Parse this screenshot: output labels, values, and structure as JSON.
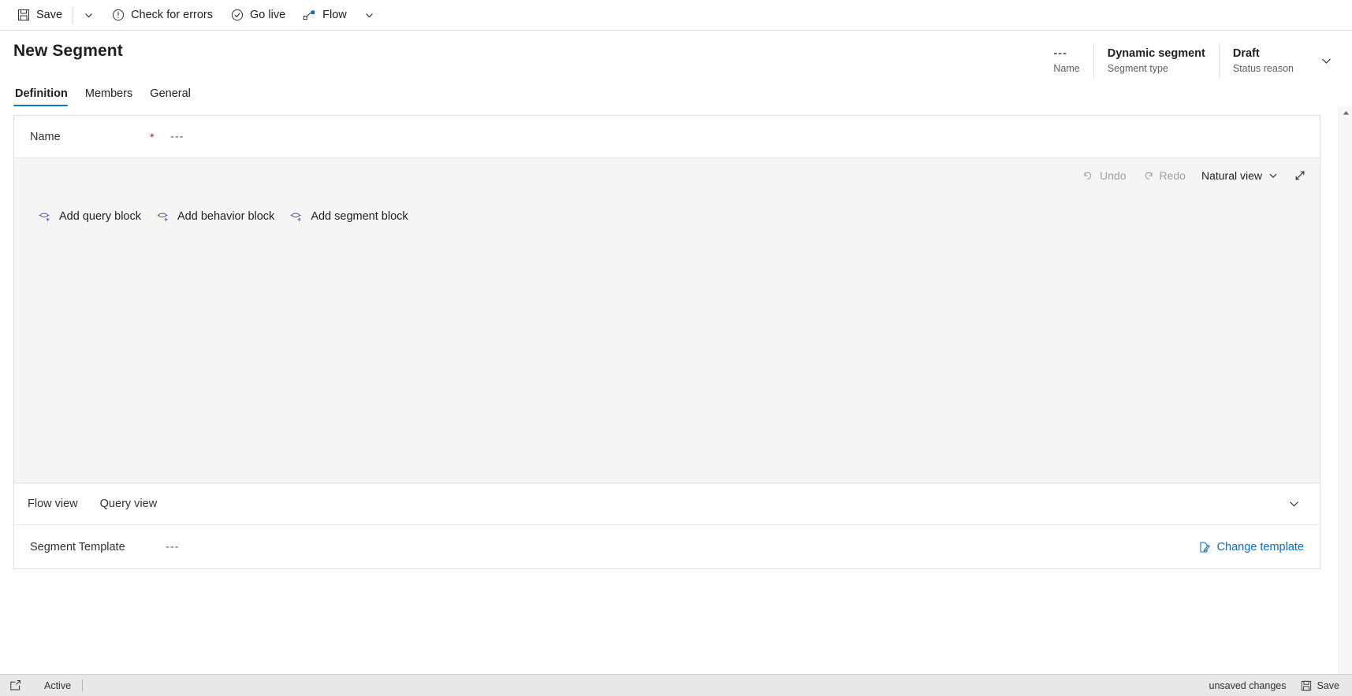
{
  "commandbar": {
    "save_label": "Save",
    "save_icon": "save-floppy-icon",
    "save_dropdown_icon": "chevron-down-icon",
    "check_errors_label": "Check for errors",
    "check_errors_icon": "exclamation-circle-icon",
    "go_live_label": "Go live",
    "go_live_icon": "check-circle-icon",
    "flow_label": "Flow",
    "flow_icon": "flow-node-icon",
    "flow_dropdown_icon": "chevron-down-icon"
  },
  "header": {
    "title": "New Segment",
    "fields": [
      {
        "value": "---",
        "label": "Name"
      },
      {
        "value": "Dynamic segment",
        "label": "Segment type"
      },
      {
        "value": "Draft",
        "label": "Status reason"
      }
    ],
    "expand_icon": "chevron-down-icon"
  },
  "tabs": [
    {
      "label": "Definition",
      "active": true
    },
    {
      "label": "Members",
      "active": false
    },
    {
      "label": "General",
      "active": false
    }
  ],
  "form": {
    "name_label": "Name",
    "name_required_marker": "*",
    "name_value": "---"
  },
  "canvas": {
    "toolbar": {
      "undo_label": "Undo",
      "undo_icon": "undo-arrow-icon",
      "undo_disabled": true,
      "redo_label": "Redo",
      "redo_icon": "redo-arrow-icon",
      "redo_disabled": true,
      "view_mode_label": "Natural view",
      "view_mode_icon": "chevron-down-icon",
      "expand_icon": "expand-diagonal-icon"
    },
    "add_blocks": [
      {
        "label": "Add query block",
        "icon": "add-query-block-icon"
      },
      {
        "label": "Add behavior block",
        "icon": "add-behavior-block-icon"
      },
      {
        "label": "Add segment block",
        "icon": "add-segment-block-icon"
      }
    ]
  },
  "viewbar": {
    "tabs": [
      {
        "label": "Flow view"
      },
      {
        "label": "Query view"
      }
    ],
    "collapse_icon": "chevron-down-icon"
  },
  "template": {
    "label": "Segment Template",
    "value": "---",
    "change_label": "Change template",
    "change_icon": "edit-page-icon"
  },
  "scrollbar": {
    "up_arrow_icon": "scroll-up-arrow-icon"
  },
  "statusbar": {
    "popout_icon": "popout-window-icon",
    "status_label": "Active",
    "unsaved_label": "unsaved changes",
    "save_label": "Save",
    "save_icon": "save-floppy-icon"
  },
  "colors": {
    "accent": "#0078d4",
    "link": "#0f6cbd",
    "required": "#a4262c",
    "canvas_bg": "#f5f5f5",
    "statusbar_bg": "#e8e8e8",
    "block_icon": "#5b5fc7"
  }
}
